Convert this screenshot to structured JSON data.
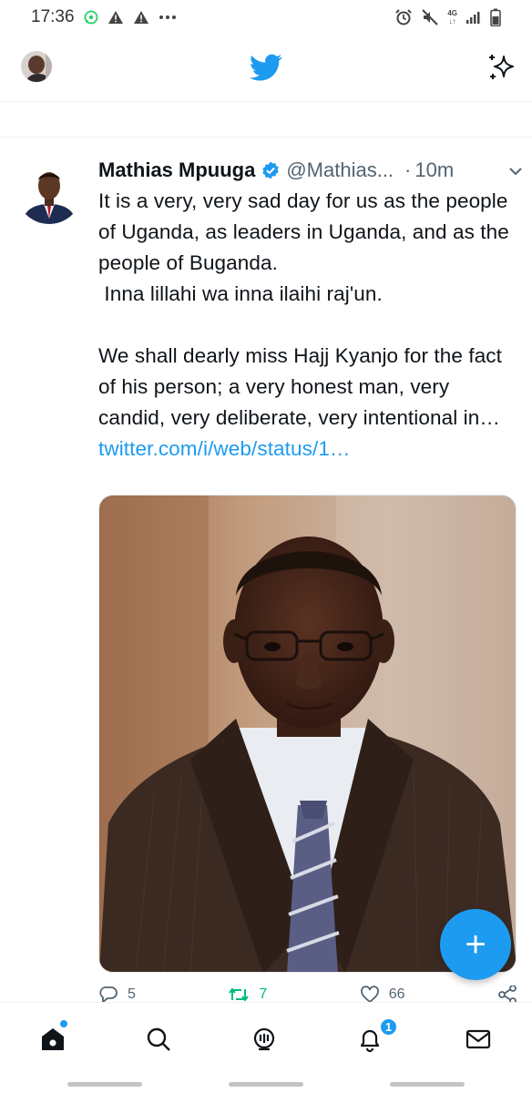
{
  "status_bar": {
    "time": "17:36",
    "notification_icons": [
      "whatsapp-icon",
      "warning-icon",
      "warning-icon",
      "more-dots-icon"
    ],
    "system_icons": [
      "alarm-icon",
      "mute-icon",
      "network-4g-icon",
      "signal-icon",
      "battery-icon"
    ],
    "network_label": "4G"
  },
  "header": {
    "logo": "twitter-bird-icon",
    "action": "sparkle-icon"
  },
  "tweet": {
    "author_name": "Mathias Mpuuga",
    "verified": true,
    "handle": "@Mathias...",
    "separator": "·",
    "time": "10m",
    "text": "It is a very, very sad day for us as the people of Uganda, as leaders in Uganda, and as the people of Buganda.\n Inna lillahi wa inna ilaihi raj'un.\n\nWe shall dearly miss Hajj Kyanjo for the fact of his person; a very honest man, very candid, very deliberate, very intentional in… ",
    "link_text": "twitter.com/i/web/status/1…",
    "media_alt": "portrait photo",
    "actions": {
      "reply_count": "5",
      "retweet_count": "7",
      "like_count": "66"
    }
  },
  "fab": {
    "label": "+"
  },
  "bottom_nav": {
    "items": [
      "home-icon",
      "search-icon",
      "spaces-icon",
      "notifications-icon",
      "messages-icon"
    ],
    "notifications_badge": "1"
  },
  "colors": {
    "accent": "#1d9bf0",
    "retweet": "#00ba7c",
    "text": "#0f1419",
    "muted": "#536471"
  }
}
